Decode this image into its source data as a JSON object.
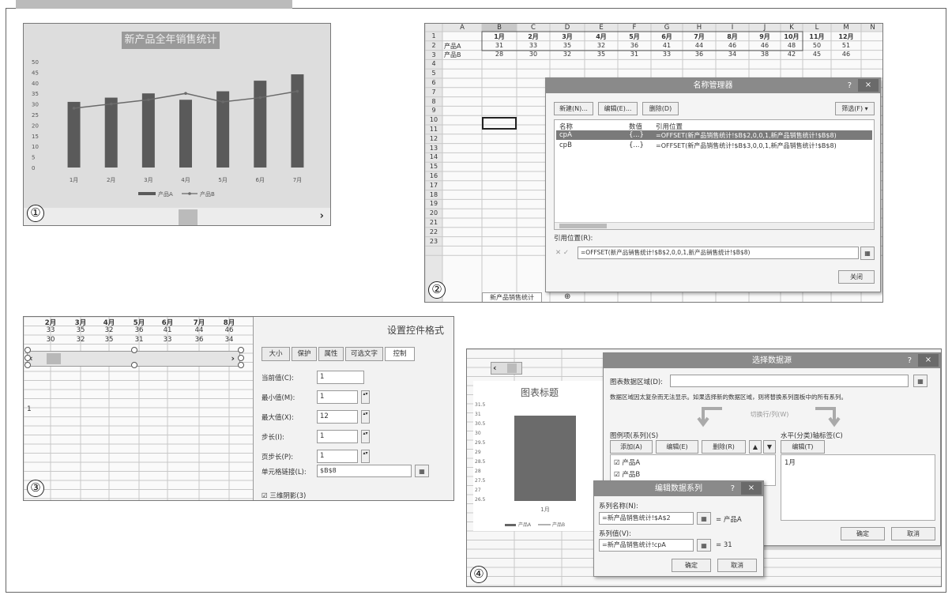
{
  "panel1": {
    "number": "①",
    "chart_data": {
      "type": "bar+line",
      "title": "新产品全年销售统计",
      "categories": [
        "1月",
        "2月",
        "3月",
        "4月",
        "5月",
        "6月",
        "7月"
      ],
      "series": [
        {
          "name": "产品A",
          "type": "bar",
          "values": [
            31,
            33,
            35,
            32,
            36,
            41,
            44
          ]
        },
        {
          "name": "产品B",
          "type": "line",
          "values": [
            28,
            30,
            32,
            35,
            31,
            33,
            36
          ]
        }
      ],
      "yticks": [
        "0",
        "5",
        "10",
        "15",
        "20",
        "25",
        "30",
        "35",
        "40",
        "45",
        "50"
      ],
      "ylim": [
        0,
        50
      ],
      "legend": "bottom",
      "scroll_right": "›"
    }
  },
  "panel2": {
    "number": "②",
    "columns": [
      "A",
      "B",
      "C",
      "D",
      "E",
      "F",
      "G",
      "H",
      "I",
      "J",
      "K",
      "L",
      "M",
      "N"
    ],
    "rows": [
      "1",
      "2",
      "3",
      "4",
      "5",
      "6",
      "7",
      "8",
      "9",
      "10",
      "11",
      "12",
      "13",
      "14",
      "15",
      "16",
      "17",
      "18",
      "19",
      "20",
      "21",
      "22",
      "23"
    ],
    "months": [
      "1月",
      "2月",
      "3月",
      "4月",
      "5月",
      "6月",
      "7月",
      "8月",
      "9月",
      "10月",
      "11月",
      "12月"
    ],
    "productA": {
      "label": "产品A",
      "values": [
        "31",
        "33",
        "35",
        "32",
        "36",
        "41",
        "44",
        "46",
        "46",
        "48",
        "50",
        "51"
      ]
    },
    "productB": {
      "label": "产品B",
      "values": [
        "28",
        "30",
        "32",
        "35",
        "31",
        "33",
        "36",
        "34",
        "38",
        "42",
        "45",
        "46"
      ]
    },
    "sheet_tab": "新产品销售统计",
    "add_sheet": "⊕",
    "dialog": {
      "title": "名称管理器",
      "help": "?",
      "close": "×",
      "new_btn": "新建(N)...",
      "edit_btn": "编辑(E)...",
      "delete_btn": "删除(D)",
      "filter_btn": "筛选(F) ▾",
      "headers": {
        "name": "名称",
        "value": "数值",
        "ref": "引用位置"
      },
      "names": [
        {
          "name": "cpA",
          "value": "{...}",
          "ref": "=OFFSET(新产品销售统计!$B$2,0,0,1,新产品销售统计!$B$8)"
        },
        {
          "name": "cpB",
          "value": "{...}",
          "ref": "=OFFSET(新产品销售统计!$B$3,0,0,1,新产品销售统计!$B$8)"
        }
      ],
      "refers_label": "引用位置(R):",
      "refers_value": "=OFFSET(新产品销售统计!$B$2,0,0,1,新产品销售统计!$B$8)",
      "close_btn": "关闭"
    }
  },
  "panel3": {
    "number": "③",
    "months": [
      "2月",
      "3月",
      "4月",
      "5月",
      "6月",
      "7月",
      "8月"
    ],
    "rowA": [
      "33",
      "35",
      "32",
      "36",
      "41",
      "44",
      "46"
    ],
    "rowB": [
      "30",
      "32",
      "35",
      "31",
      "33",
      "36",
      "34"
    ],
    "cell_value": "1",
    "scroll_left": "‹",
    "scroll_right": "›",
    "dialog": {
      "title": "设置控件格式",
      "tabs": [
        "大小",
        "保护",
        "属性",
        "可选文字",
        "控制"
      ],
      "fields": [
        {
          "label": "当前值(C):",
          "value": "1"
        },
        {
          "label": "最小值(M):",
          "value": "1"
        },
        {
          "label": "最大值(X):",
          "value": "12"
        },
        {
          "label": "步长(I):",
          "value": "1"
        },
        {
          "label": "页步长(P):",
          "value": "1"
        }
      ],
      "link_label": "单元格链接(L):",
      "link_value": "$B$8",
      "shading": "三维阴影(3)"
    }
  },
  "panel4": {
    "number": "④",
    "chart_title": "图表标题",
    "mini_chart": {
      "type": "bar",
      "yticks": [
        "31.5",
        "31",
        "30.5",
        "30",
        "29.5",
        "29",
        "28.5",
        "28",
        "27.5",
        "27",
        "26.5"
      ],
      "categories": [
        "1月"
      ],
      "values": [
        31
      ],
      "legend": [
        "产品A",
        "产品B"
      ]
    },
    "scroll_left": "‹",
    "dialog": {
      "title": "选择数据源",
      "help": "?",
      "close": "×",
      "range_label": "图表数据区域(D):",
      "note": "数据区域因太复杂而无法显示。如果选择新的数据区域，则将替换系列面板中的所有系列。",
      "switch_btn": "切换行/列(W)",
      "legend_label": "图例项(系列)(S)",
      "add_btn": "添加(A)",
      "edit_btn": "编辑(E)",
      "delete_btn": "删除(R)",
      "series": [
        "产品A",
        "产品B"
      ],
      "axis_label": "水平(分类)轴标签(C)",
      "axis_edit": "编辑(T)",
      "axis_items": [
        "1月"
      ],
      "ok": "确定",
      "cancel": "取消"
    },
    "subdialog": {
      "title": "编辑数据系列",
      "help": "?",
      "close": "×",
      "name_label": "系列名称(N):",
      "name_value": "=新产品销售统计!$A$2",
      "name_result": "= 产品A",
      "values_label": "系列值(V):",
      "values_value": "=新产品销售统计!cpA",
      "values_result": "= 31",
      "ok": "确定",
      "cancel": "取消"
    }
  }
}
